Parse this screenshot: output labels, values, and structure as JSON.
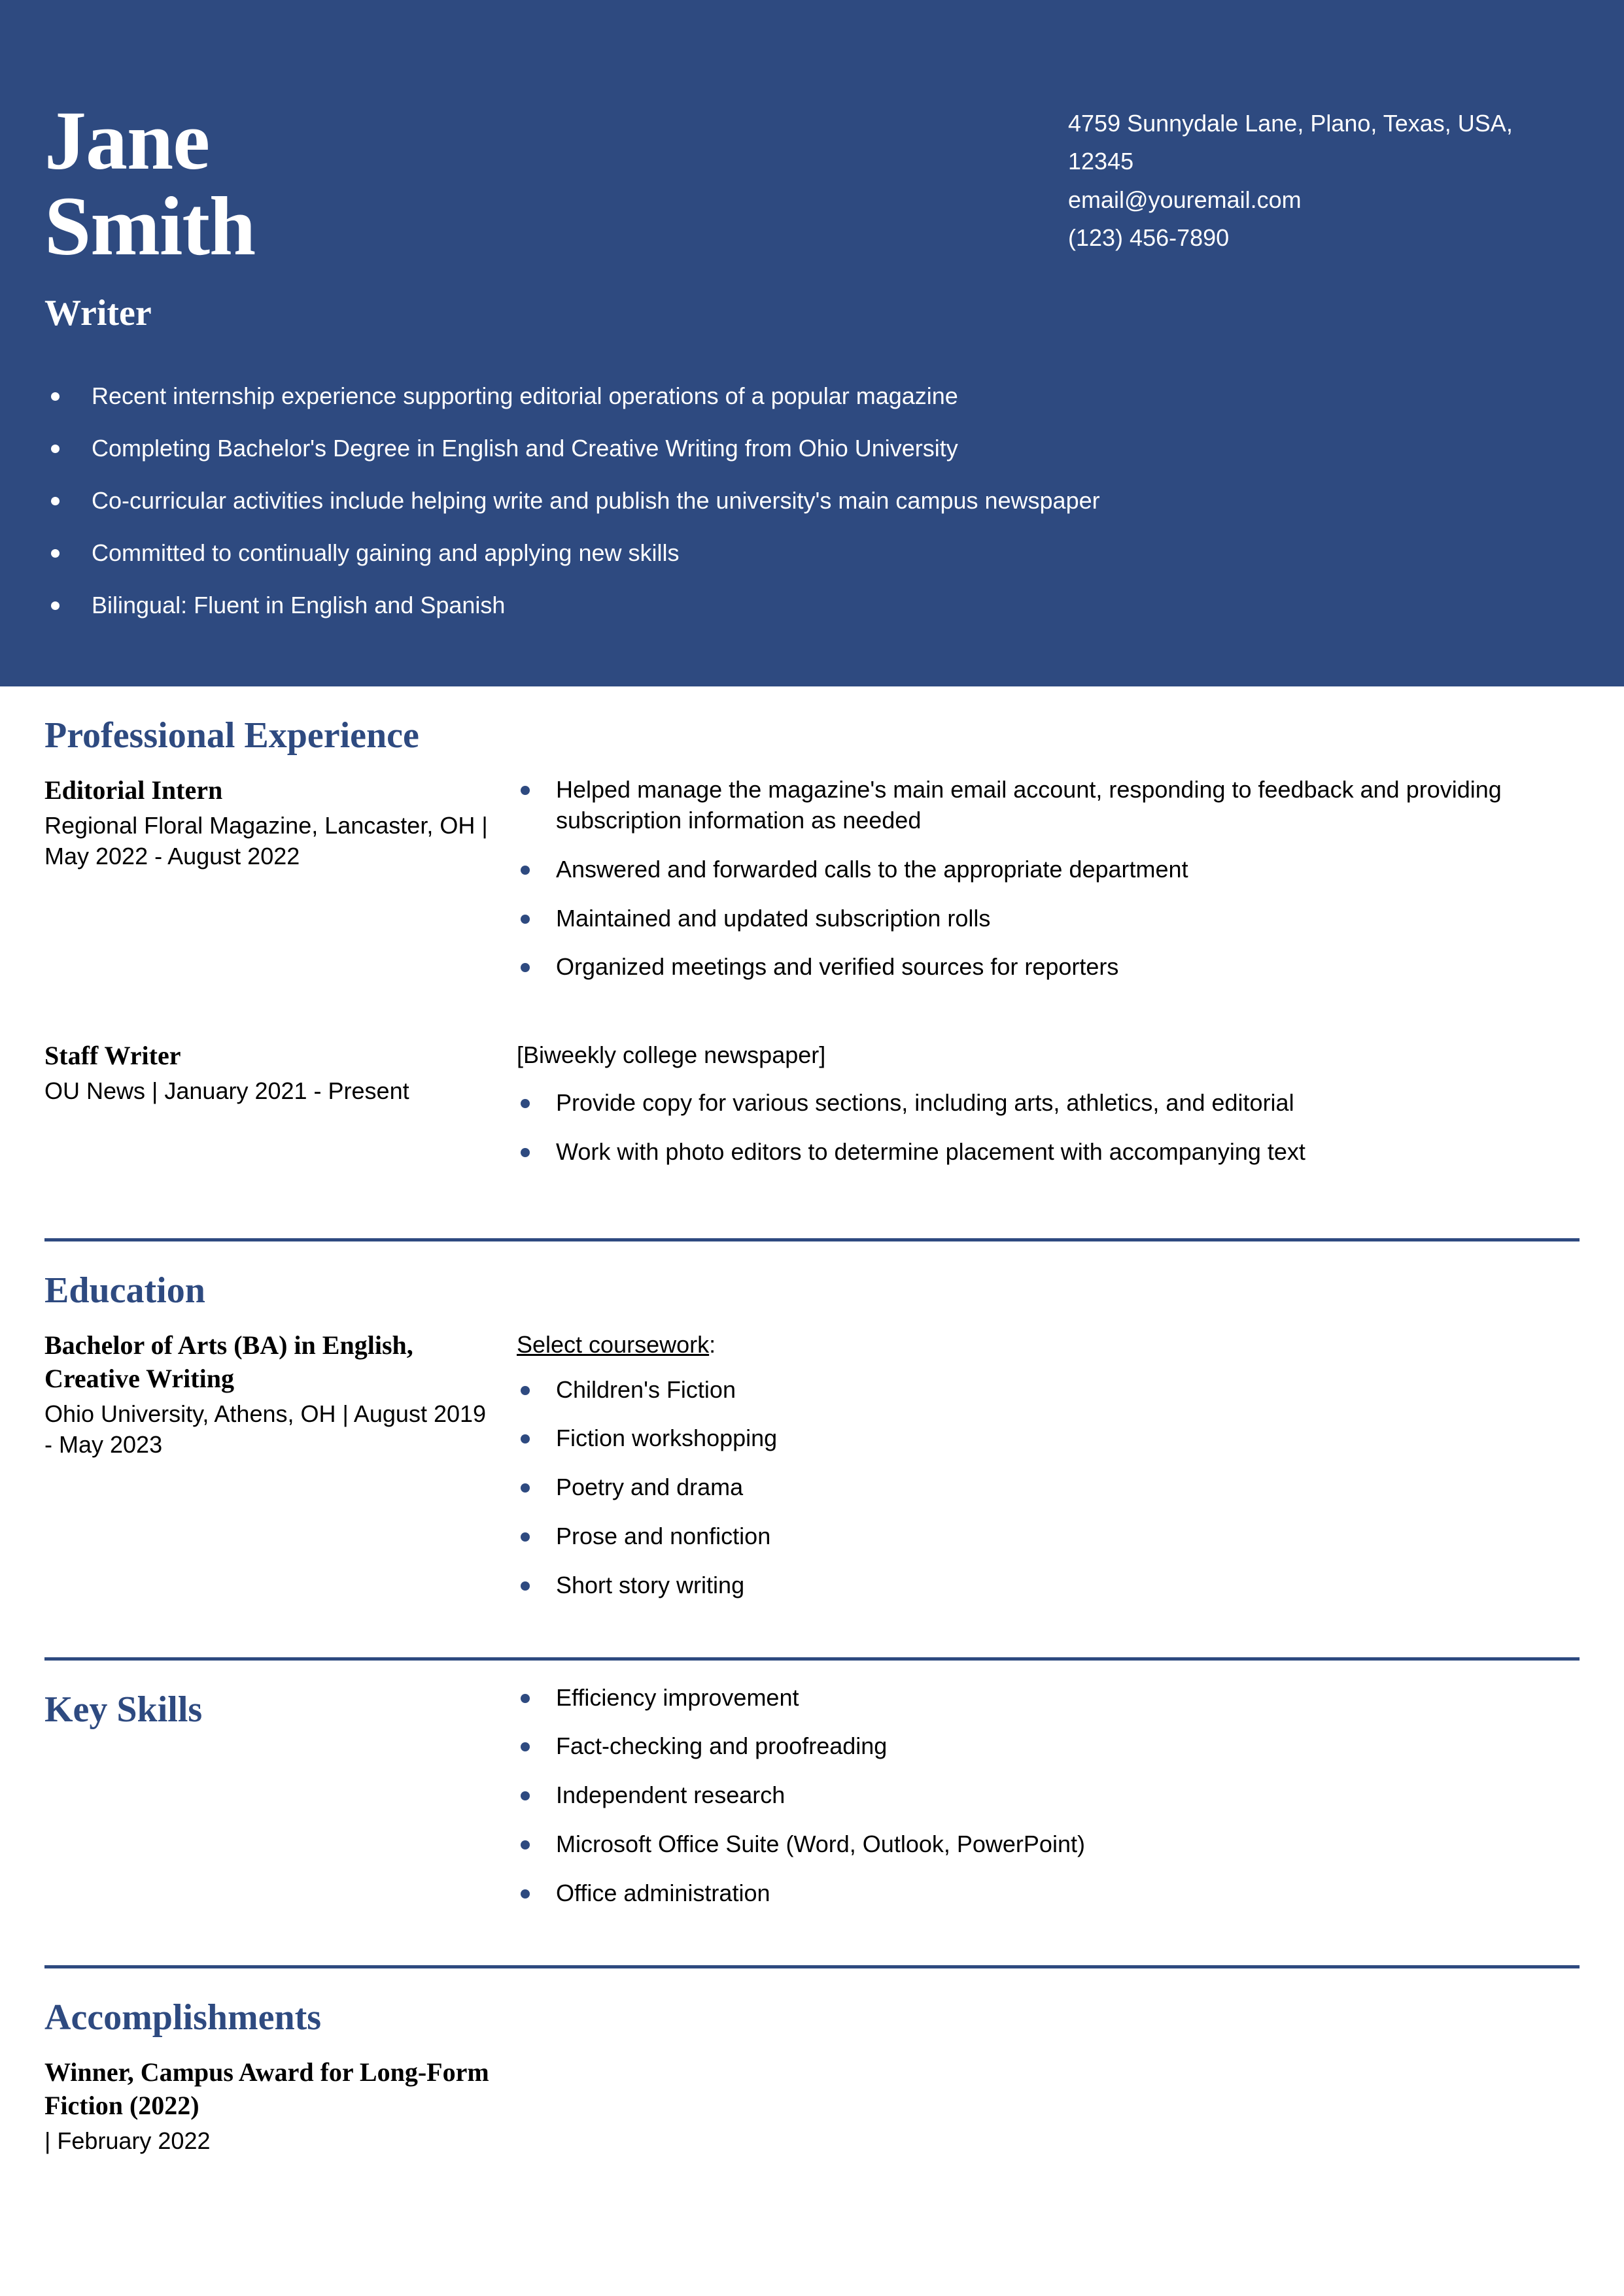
{
  "header": {
    "name_line1": "Jane",
    "name_line2": "Smith",
    "job_title": "Writer",
    "contact": {
      "address": "4759 Sunnydale Lane, Plano, Texas, USA, 12345",
      "email": "email@youremail.com",
      "phone": "(123) 456-7890"
    },
    "summary": [
      "Recent internship experience supporting editorial operations of a popular magazine",
      "Completing Bachelor's Degree in English and Creative Writing from Ohio University",
      "Co-curricular activities include helping write and publish the university's main campus newspaper",
      "Committed to continually gaining and applying new skills",
      "Bilingual: Fluent in English and Spanish"
    ]
  },
  "sections": {
    "experience": {
      "title": "Professional Experience",
      "entries": [
        {
          "title": "Editorial Intern",
          "meta": "Regional Floral Magazine, Lancaster, OH | May 2022 - August 2022",
          "bullets": [
            "Helped manage the magazine's main email account, responding to feedback and providing subscription information as needed",
            "Answered and forwarded calls to the appropriate department",
            "Maintained and updated subscription rolls",
            "Organized meetings and verified sources for reporters"
          ]
        },
        {
          "title": "Staff Writer",
          "meta": "OU News | January 2021 - Present",
          "note": "[Biweekly college newspaper]",
          "bullets": [
            "Provide copy for various sections, including arts, athletics, and editorial",
            "Work with photo editors to determine placement with accompanying text"
          ]
        }
      ]
    },
    "education": {
      "title": "Education",
      "entry": {
        "title": "Bachelor of Arts (BA) in English, Creative Writing",
        "meta": "Ohio University, Athens, OH | August 2019 - May 2023",
        "coursework_label": "Select coursework",
        "coursework_colon": ":",
        "coursework": [
          "Children's Fiction",
          "Fiction workshopping",
          "Poetry and drama",
          "Prose and nonfiction",
          "Short story writing"
        ]
      }
    },
    "skills": {
      "title": "Key Skills",
      "items": [
        "Efficiency improvement",
        "Fact-checking and proofreading",
        "Independent research",
        "Microsoft Office Suite (Word, Outlook, PowerPoint)",
        "Office administration"
      ]
    },
    "accomplishments": {
      "title": "Accomplishments",
      "entry": {
        "title": "Winner, Campus Award for Long-Form Fiction (2022)",
        "meta": "| February 2022"
      }
    }
  },
  "colors": {
    "brand_navy": "#2E4A80",
    "text_black": "#000000",
    "background": "#ffffff"
  }
}
